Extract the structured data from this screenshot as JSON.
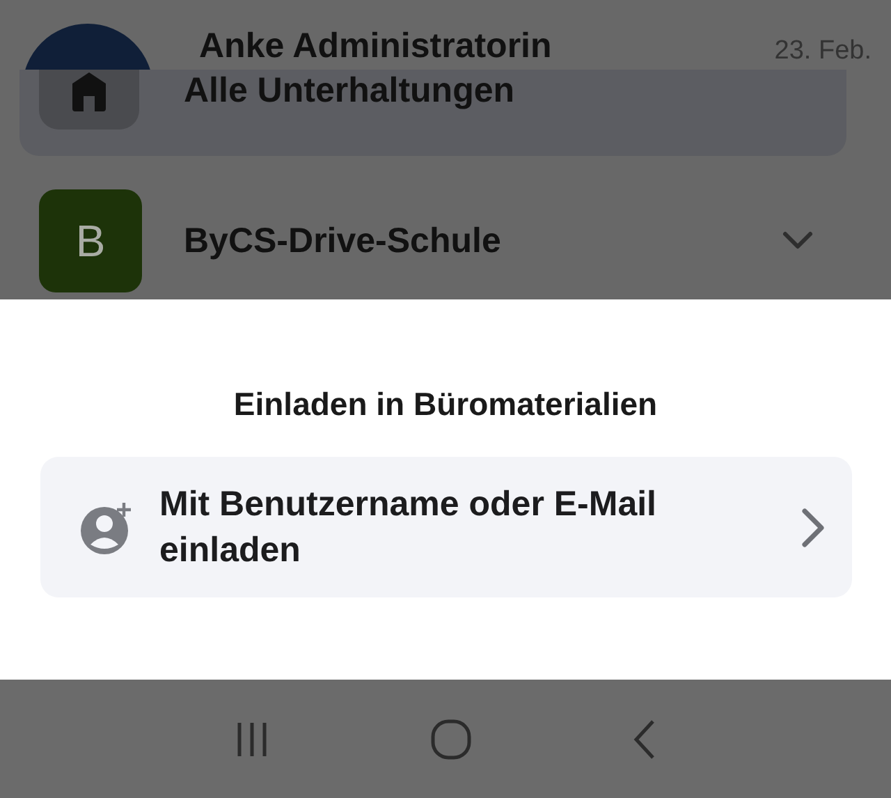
{
  "background_list": {
    "conversation": {
      "name": "Anke Administratorin",
      "date": "23. Feb."
    },
    "filter_card": {
      "label": "Alle Unterhaltungen"
    },
    "groups": [
      {
        "initial": "B",
        "name": "ByCS-Drive-Schule",
        "color": "#1d3309",
        "expanded": false
      }
    ]
  },
  "sheet": {
    "title": "Einladen in Büromaterialien",
    "options": [
      {
        "label": "Mit Benutzername oder E-Mail einladen"
      }
    ]
  }
}
